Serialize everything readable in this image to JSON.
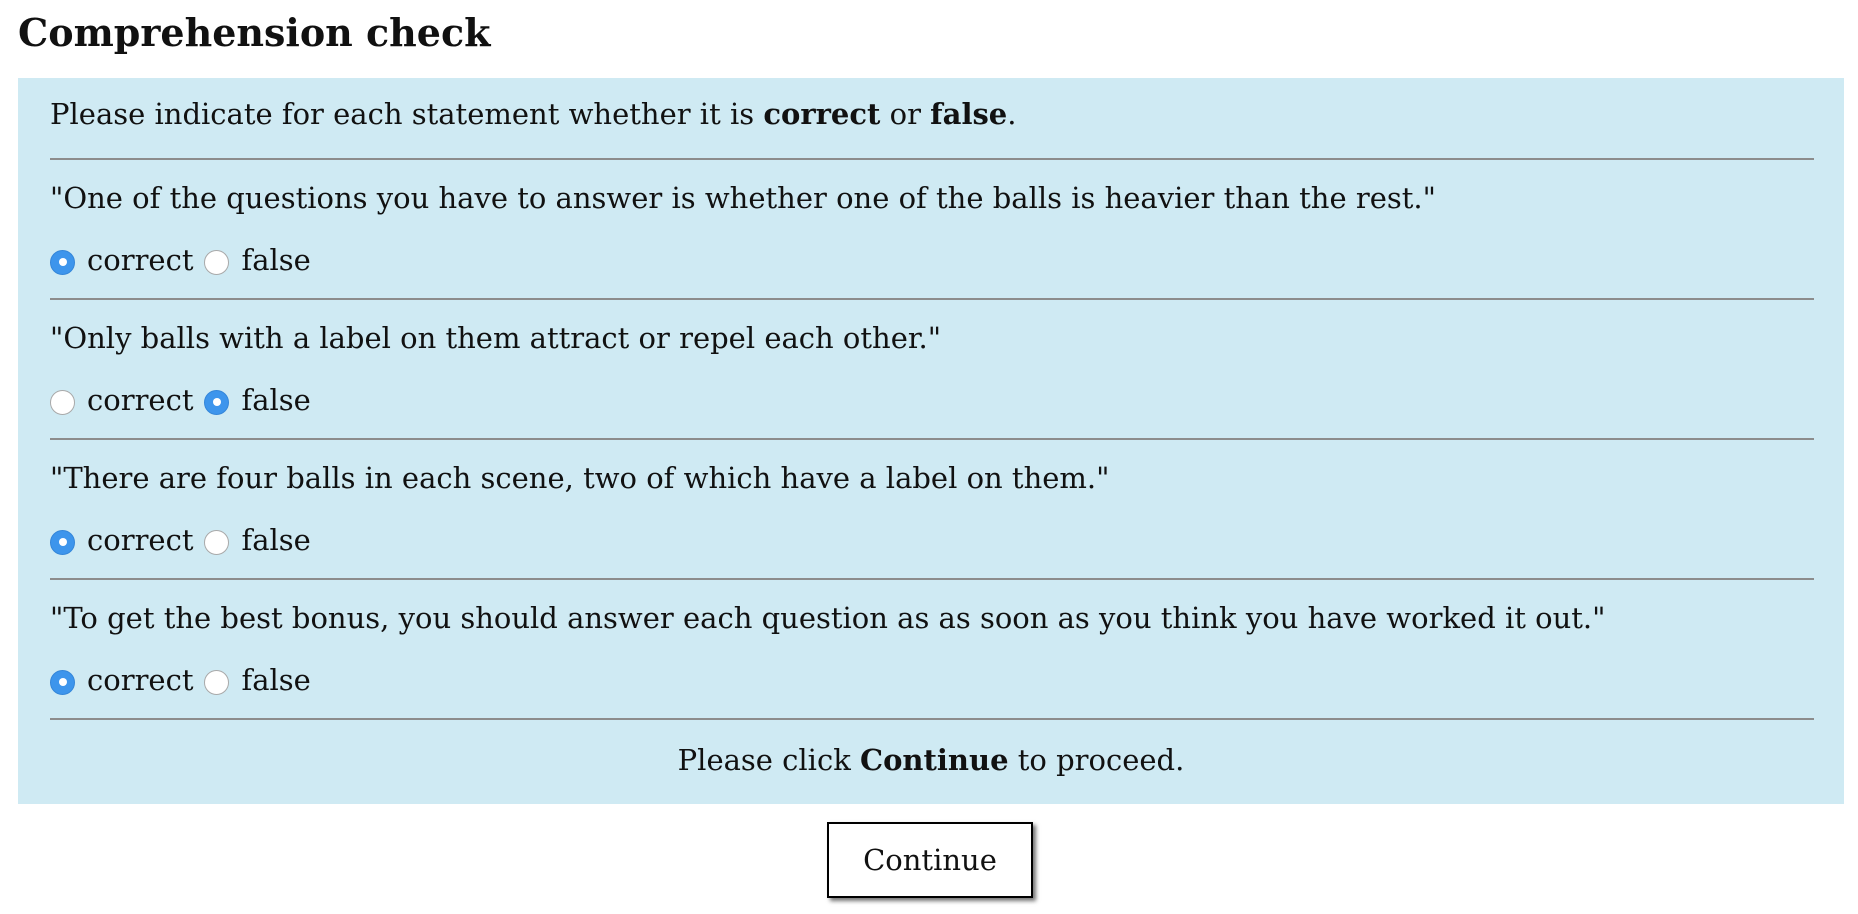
{
  "page": {
    "title": "Comprehension check"
  },
  "intro": {
    "prefix": "Please indicate for each statement whether it is ",
    "correct_word": "correct",
    "middle": " or ",
    "false_word": "false",
    "suffix": "."
  },
  "questions": [
    {
      "statement": "\"One of the questions you have to answer is whether one of the balls is heavier than the rest.\"",
      "option_correct": "correct",
      "option_false": "false",
      "selected": "correct"
    },
    {
      "statement": "\"Only balls with a label on them attract or repel each other.\"",
      "option_correct": "correct",
      "option_false": "false",
      "selected": "false"
    },
    {
      "statement": "\"There are four balls in each scene, two of which have a label on them.\"",
      "option_correct": "correct",
      "option_false": "false",
      "selected": "correct"
    },
    {
      "statement": "\"To get the best bonus, you should answer each question as as soon as you think you have worked it out.\"",
      "option_correct": "correct",
      "option_false": "false",
      "selected": "correct"
    }
  ],
  "footer": {
    "prefix": "Please click ",
    "button_word": "Continue",
    "suffix": " to proceed."
  },
  "continue_button": {
    "label": "Continue"
  },
  "colors": {
    "panel_background": "#cfeaf3",
    "radio_selected": "#3d95ec",
    "divider": "#8c8c8c"
  }
}
